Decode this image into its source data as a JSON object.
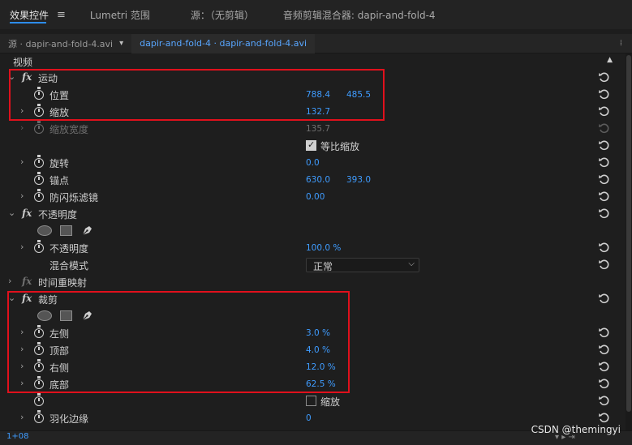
{
  "tabs": [
    {
      "label": "效果控件",
      "active": true
    },
    {
      "label": "Lumetri 范围",
      "active": false
    },
    {
      "label": "源：（无剪辑）",
      "active": false
    },
    {
      "label": "音频剪辑混合器: dapir-and-fold-4",
      "active": false
    }
  ],
  "tab_menu_icon": "≡",
  "subtabs": [
    {
      "label": "源 · dapir-and-fold-4.avi"
    },
    {
      "label": "dapir-and-fold-4 · dapir-and-fold-4.avi"
    }
  ],
  "subtab_arrow": "▾",
  "panel_grip": "⁞",
  "section_label": "视频",
  "scroll_up": "▲",
  "motion": {
    "name": "运动",
    "position": {
      "label": "位置",
      "x": "788.4",
      "y": "485.5"
    },
    "scale": {
      "label": "缩放",
      "value": "132.7"
    },
    "scale_width": {
      "label": "缩放宽度",
      "value": "135.7"
    },
    "uniform_scale": {
      "label": "等比缩放",
      "checked": true
    },
    "rotation": {
      "label": "旋转",
      "value": "0.0"
    },
    "anchor": {
      "label": "锚点",
      "x": "630.0",
      "y": "393.0"
    },
    "anti_flicker": {
      "label": "防闪烁滤镜",
      "value": "0.00"
    }
  },
  "opacity": {
    "name": "不透明度",
    "opacity": {
      "label": "不透明度",
      "value": "100.0 %"
    },
    "blend": {
      "label": "混合模式",
      "value": "正常"
    }
  },
  "time_remap": {
    "name": "时间重映射"
  },
  "crop": {
    "name": "裁剪",
    "left": {
      "label": "左侧",
      "value": "3.0 %"
    },
    "top": {
      "label": "顶部",
      "value": "4.0 %"
    },
    "right": {
      "label": "右侧",
      "value": "12.0 %"
    },
    "bottom": {
      "label": "底部",
      "value": "62.5 %"
    },
    "zoom": {
      "label": "缩放",
      "checked": false
    },
    "feather": {
      "label": "羽化边缘",
      "value": "0"
    }
  },
  "fx_label": "fx",
  "chevron_right": "›",
  "chevron_down": "⌄",
  "dropdown_arrow": "⌵",
  "timecode": "1+08",
  "watermark": "CSDN @themingyi",
  "colors": {
    "accent": "#2d8ceb",
    "value_blue": "#3f9cff",
    "highlight_red": "#e0101c",
    "background": "#1e1e1e"
  }
}
